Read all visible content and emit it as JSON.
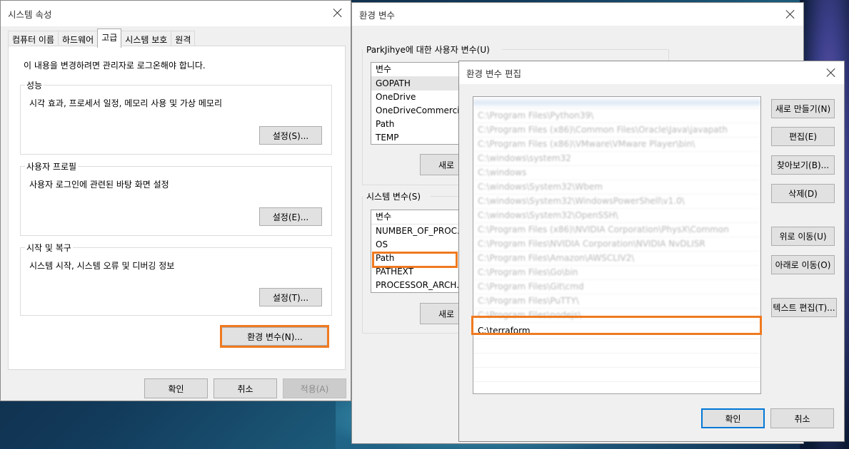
{
  "sysprops": {
    "title": "시스템 속성",
    "tabs": [
      "컴퓨터 이름",
      "하드웨어",
      "고급",
      "시스템 보호",
      "원격"
    ],
    "notice": "이 내용을 변경하려면 관리자로 로그온해야 합니다.",
    "performance": {
      "title": "성능",
      "desc": "시각 효과, 프로세서 일정, 메모리 사용 및 가상 메모리",
      "button": "설정(S)..."
    },
    "profile": {
      "title": "사용자 프로필",
      "desc": "사용자 로그인에 관련된 바탕 화면 설정",
      "button": "설정(E)..."
    },
    "startup": {
      "title": "시작 및 복구",
      "desc": "시스템 시작, 시스템 오류 및 디버깅 정보",
      "button": "설정(T)..."
    },
    "env_button": "환경 변수(N)...",
    "ok": "확인",
    "cancel": "취소",
    "apply": "적용(A)"
  },
  "envvars": {
    "title": "환경 변수",
    "user_label": "ParkJihye에 대한 사용자 변수(U)",
    "user_header": "변수",
    "user_vars": [
      "GOPATH",
      "OneDrive",
      "OneDriveCommerci...",
      "Path",
      "TEMP"
    ],
    "user_new": "새로",
    "sys_label": "시스템 변수(S)",
    "sys_header": "변수",
    "sys_vars": [
      "NUMBER_OF_PROC...",
      "OS",
      "Path",
      "PATHEXT",
      "PROCESSOR_ARCH..."
    ],
    "sys_new": "새로"
  },
  "editor": {
    "title": "환경 변수 편집",
    "paths": [
      "",
      "C:\\Program Files\\Python39\\",
      "C:\\Program Files (x86)\\Common Files\\Oracle\\Java\\javapath",
      "C:\\Program Files (x86)\\VMware\\VMware Player\\bin\\",
      "C:\\windows\\system32",
      "C:\\windows",
      "C:\\windows\\System32\\Wbem",
      "C:\\windows\\System32\\WindowsPowerShell\\v1.0\\",
      "C:\\windows\\System32\\OpenSSH\\",
      "C:\\Program Files (x86)\\NVIDIA Corporation\\PhysX\\Common",
      "C:\\Program Files\\NVIDIA Corporation\\NVIDIA NvDLISR",
      "C:\\Program Files\\Amazon\\AWSCLIV2\\",
      "C:\\Program Files\\Go\\bin",
      "C:\\Program Files\\Git\\cmd",
      "C:\\Program Files\\PuTTY\\",
      "C:\\Program Files\\nodejs\\"
    ],
    "new_entry": "C:\\terraform",
    "buttons": {
      "new": "새로 만들기(N)",
      "edit": "편집(E)",
      "browse": "찾아보기(B)...",
      "delete": "삭제(D)",
      "up": "위로 이동(U)",
      "down": "아래로 이동(O)",
      "text": "텍스트 편집(T)..."
    },
    "ok": "확인",
    "cancel": "취소"
  },
  "highlight_color": "#f07a20"
}
